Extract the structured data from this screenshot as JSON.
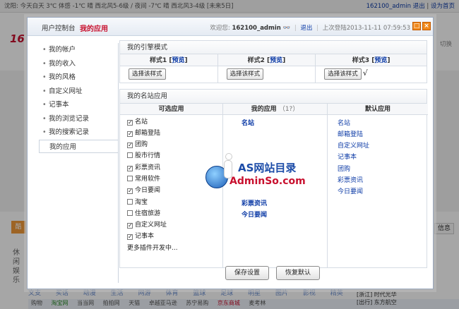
{
  "background": {
    "topbar_left": "沈阳: 今天白天 3℃ 体感 -1℃ 晴 西北风5-6级 / 夜间 -7℃ 晴 西北风3-4级 [未来5日]",
    "topbar_user": "162100_admin",
    "topbar_logout": "退出",
    "topbar_home": "设为首页",
    "logo": "16",
    "side_link": "切换",
    "orange_tab": "酷",
    "vert_text": "休闲娱乐",
    "right_btn": "信息",
    "nav_items": [
      "文支",
      "买话",
      "动漫",
      "生活",
      "网游",
      "体育",
      "篮球",
      "足球",
      "明星",
      "图片",
      "影视",
      "精英"
    ],
    "row_items": [
      "购物",
      "淘宝网",
      "当当网",
      "拍拍网",
      "天猫",
      "卓越亚马逊",
      "苏宁易购",
      "京东商城",
      "麦考林"
    ],
    "right_box_1": "[浙江] 时代光华",
    "right_box_2": "[出行] 东方航空"
  },
  "dialog": {
    "tab_control_panel": "用户控制台",
    "tab_my_apps": "我的应用",
    "welcome": "欢迎您:",
    "username": "162100_admin",
    "logout": "退出",
    "last_login": "上次登陆2013-11-11 07:59:53",
    "min_icon": "□",
    "close_icon": "×"
  },
  "sidebar": {
    "items": [
      "我的帐户",
      "我的收入",
      "我的风格",
      "自定义网址",
      "记事本",
      "我的浏览记录",
      "我的搜索记录",
      "我的应用"
    ],
    "active_index": 7
  },
  "engine": {
    "title": "我的引擎模式",
    "styles": [
      {
        "label": "样式1",
        "preview": "预览"
      },
      {
        "label": "样式2",
        "preview": "预览"
      },
      {
        "label": "样式3",
        "preview": "预览"
      }
    ],
    "select_label": "选择该样式",
    "selected_mark": "√",
    "selected_index": 2
  },
  "apps": {
    "title": "我的名站应用",
    "col_optional": "可选应用",
    "col_mine": "我的应用",
    "col_mine_hint": "（1?）",
    "col_default": "默认应用",
    "optional": [
      {
        "label": "名站",
        "checked": true
      },
      {
        "label": "邮箱登陆",
        "checked": true
      },
      {
        "label": "团购",
        "checked": true
      },
      {
        "label": "股市行情",
        "checked": false
      },
      {
        "label": "彩票资讯",
        "checked": true
      },
      {
        "label": "常用软件",
        "checked": false
      },
      {
        "label": "今日要闻",
        "checked": true
      },
      {
        "label": "淘宝",
        "checked": false
      },
      {
        "label": "住宿旅游",
        "checked": false
      },
      {
        "label": "自定义网址",
        "checked": true
      },
      {
        "label": "记事本",
        "checked": true
      },
      {
        "label": "更多插件开发中...",
        "checked": null
      }
    ],
    "mine": [
      "名站",
      "",
      "",
      "",
      "",
      "",
      "",
      "彩票资讯",
      "今日要闻"
    ],
    "defaults": [
      "名站",
      "邮箱登陆",
      "自定义网址",
      "记事本",
      "团购",
      "彩票资讯",
      "今日要闻"
    ]
  },
  "actions": {
    "save": "保存设置",
    "reset": "恢复默认"
  },
  "watermark": {
    "line1": "AS网站目录",
    "line2": "AdminSo.com"
  }
}
